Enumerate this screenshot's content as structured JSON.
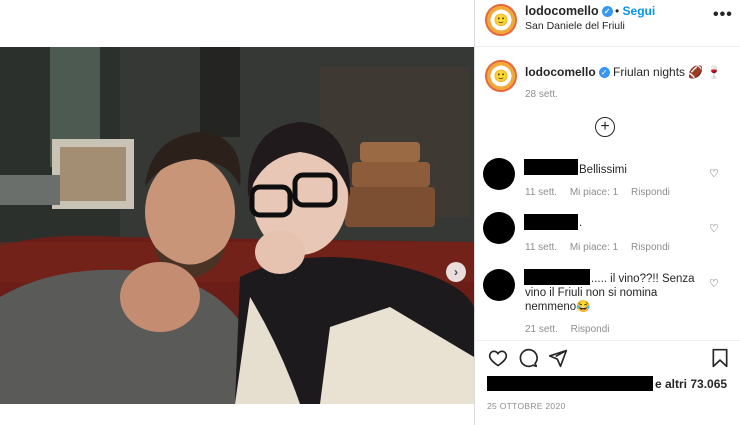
{
  "post": {
    "username": "lodocomello",
    "follow_label": "Segui",
    "location": "San Daniele del Friuli",
    "more_label": "•••",
    "caption_user": "lodocomello",
    "caption_text": "Friulan nights 🏈 🍷",
    "caption_time": "28 sett.",
    "likes_suffix": "e altri 73.065",
    "date": "25 OTTOBRE 2020"
  },
  "comments": [
    {
      "text": "Bellissimi",
      "time": "11 sett.",
      "likes": "Mi piace: 1",
      "reply": "Rispondi"
    },
    {
      "text": ".",
      "time": "11 sett.",
      "likes": "Mi piace: 1",
      "reply": "Rispondi"
    },
    {
      "text": "..... il vino??!! Senza vino il Friuli non si nomina nemmeno😂",
      "time": "21 sett.",
      "likes": "",
      "reply": "Rispondi"
    }
  ],
  "icons": {
    "verified": "✓",
    "add_comment": "+",
    "heart": "♡",
    "next": "›"
  },
  "colors": {
    "link": "#0095f6",
    "verified": "#3897f0",
    "muted": "#8e8e8e"
  }
}
